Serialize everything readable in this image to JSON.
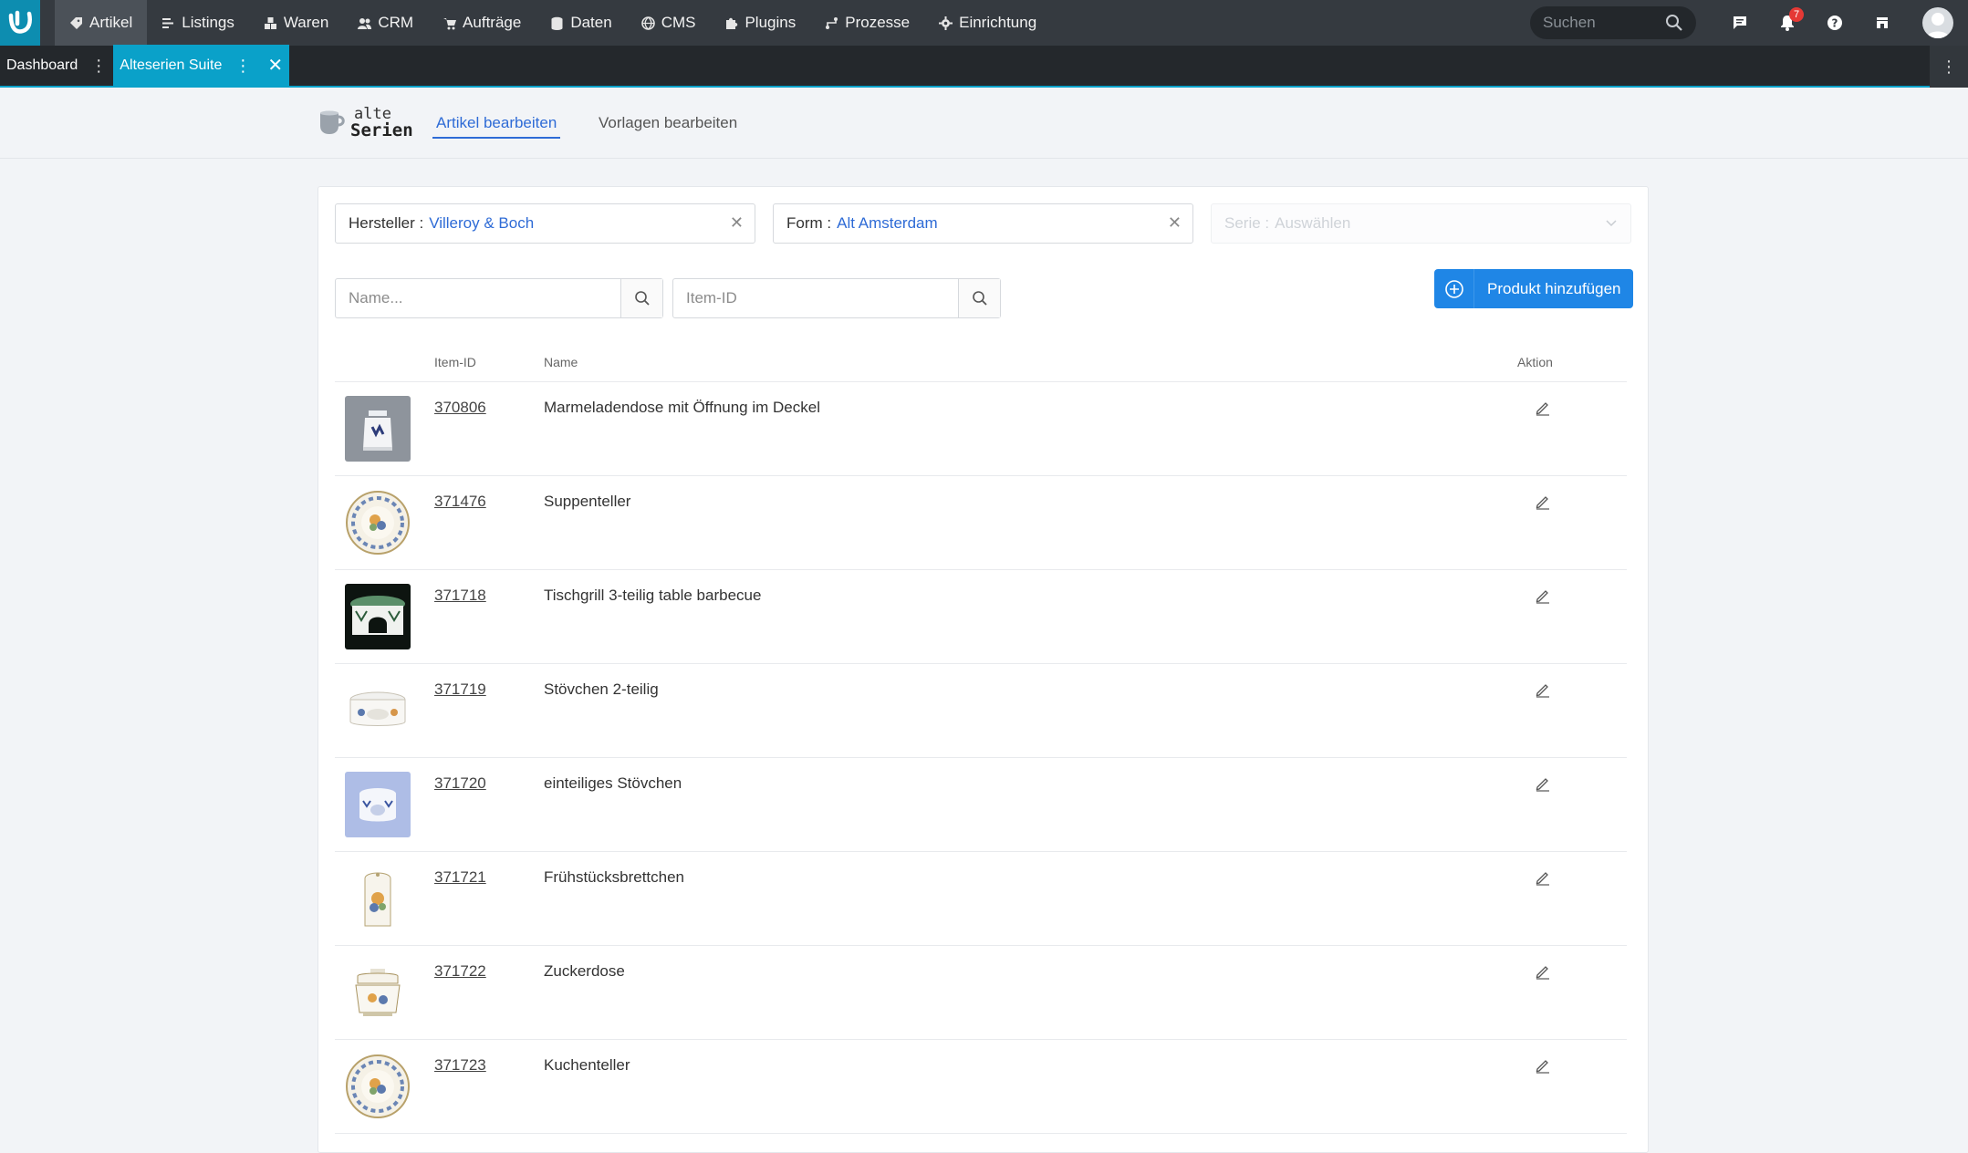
{
  "topnav": {
    "items": [
      {
        "label": "Artikel",
        "icon": "tag-icon",
        "active": true
      },
      {
        "label": "Listings",
        "icon": "list-icon"
      },
      {
        "label": "Waren",
        "icon": "boxes-icon"
      },
      {
        "label": "CRM",
        "icon": "users-icon"
      },
      {
        "label": "Aufträge",
        "icon": "cart-icon"
      },
      {
        "label": "Daten",
        "icon": "database-icon"
      },
      {
        "label": "CMS",
        "icon": "globe-icon"
      },
      {
        "label": "Plugins",
        "icon": "puzzle-icon"
      },
      {
        "label": "Prozesse",
        "icon": "process-icon"
      },
      {
        "label": "Einrichtung",
        "icon": "gear-icon"
      }
    ],
    "search_placeholder": "Suchen",
    "notification_count": "7"
  },
  "tabs": [
    {
      "label": "Dashboard",
      "active": false
    },
    {
      "label": "Alteserien Suite",
      "active": true
    }
  ],
  "subheader": {
    "brand_line1": "alte",
    "brand_line2": "Serien",
    "tab_edit_articles": "Artikel bearbeiten",
    "tab_edit_templates": "Vorlagen bearbeiten"
  },
  "filters": {
    "manufacturer_label": "Hersteller :",
    "manufacturer_value": "Villeroy & Boch",
    "form_label": "Form :",
    "form_value": "Alt Amsterdam",
    "series_label": "Serie :",
    "series_value": "Auswählen"
  },
  "search": {
    "name_placeholder": "Name...",
    "id_placeholder": "Item-ID"
  },
  "add_button_label": "Produkt hinzufügen",
  "table": {
    "headers": {
      "item_id": "Item-ID",
      "name": "Name",
      "action": "Aktion"
    },
    "rows": [
      {
        "id": "370806",
        "name": "Marmeladendose mit Öffnung im Deckel",
        "thumb": "jar"
      },
      {
        "id": "371476",
        "name": "Suppenteller",
        "thumb": "plate"
      },
      {
        "id": "371718",
        "name": "Tischgrill 3-teilig table barbecue",
        "thumb": "grill"
      },
      {
        "id": "371719",
        "name": "Stövchen 2-teilig",
        "thumb": "warmer"
      },
      {
        "id": "371720",
        "name": "einteiliges Stövchen",
        "thumb": "warmer-blue"
      },
      {
        "id": "371721",
        "name": "Frühstücksbrettchen",
        "thumb": "board"
      },
      {
        "id": "371722",
        "name": "Zuckerdose",
        "thumb": "sugar"
      },
      {
        "id": "371723",
        "name": "Kuchenteller",
        "thumb": "plate"
      }
    ]
  }
}
